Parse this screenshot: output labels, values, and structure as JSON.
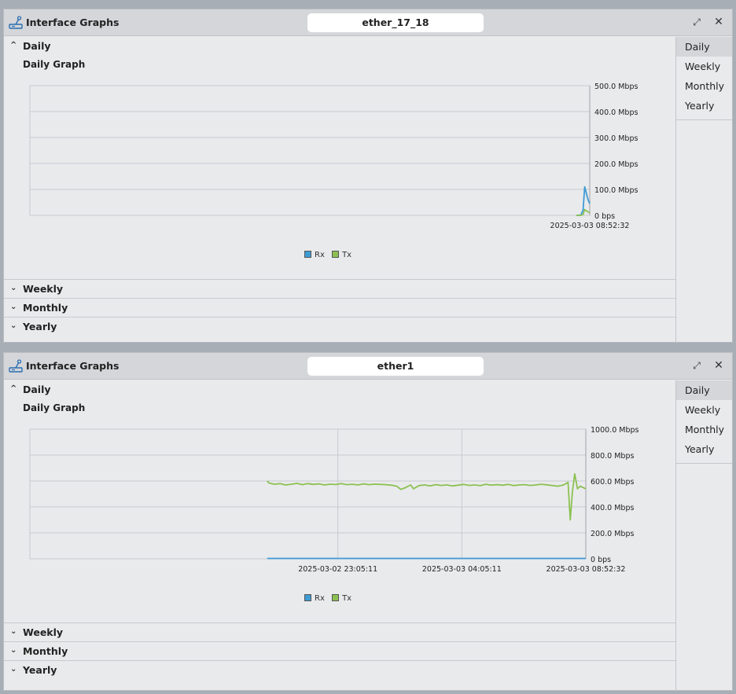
{
  "colors": {
    "rx": "#3d9bd4",
    "tx": "#8cc152",
    "grid": "#c8cbd0"
  },
  "windows": [
    {
      "title": "Interface Graphs",
      "interface": "ether_17_18",
      "icon": "interface-graph-icon",
      "sidebar": [
        "Daily",
        "Weekly",
        "Monthly",
        "Yearly"
      ],
      "sidebar_active": 0,
      "sections": {
        "daily": "Daily",
        "weekly": "Weekly",
        "monthly": "Monthly",
        "yearly": "Yearly"
      },
      "graph_title": "Daily Graph",
      "legend": {
        "rx": "Rx",
        "tx": "Tx"
      },
      "chart_data": {
        "type": "line",
        "y_ticks": [
          "500.0 Mbps",
          "400.0 Mbps",
          "300.0 Mbps",
          "200.0 Mbps",
          "100.0 Mbps",
          "0 bps"
        ],
        "ylim": [
          0,
          500
        ],
        "x_ticks": [
          {
            "label": "2025-03-03 08:52:32",
            "pos": 1.0
          }
        ],
        "xlim": [
          0,
          1
        ],
        "series": [
          {
            "name": "Rx",
            "points": [
              [
                0.976,
                0
              ],
              [
                0.984,
                1
              ],
              [
                0.988,
                20
              ],
              [
                0.991,
                110
              ],
              [
                0.994,
                85
              ],
              [
                0.997,
                60
              ],
              [
                1.0,
                45
              ]
            ]
          },
          {
            "name": "Tx",
            "points": [
              [
                0.976,
                0
              ],
              [
                0.984,
                0
              ],
              [
                0.988,
                3
              ],
              [
                0.991,
                22
              ],
              [
                0.994,
                18
              ],
              [
                0.997,
                13
              ],
              [
                1.0,
                10
              ]
            ]
          }
        ]
      }
    },
    {
      "title": "Interface Graphs",
      "interface": "ether1",
      "icon": "interface-graph-icon",
      "sidebar": [
        "Daily",
        "Weekly",
        "Monthly",
        "Yearly"
      ],
      "sidebar_active": 0,
      "sections": {
        "daily": "Daily",
        "weekly": "Weekly",
        "monthly": "Monthly",
        "yearly": "Yearly"
      },
      "graph_title": "Daily Graph",
      "legend": {
        "rx": "Rx",
        "tx": "Tx"
      },
      "chart_data": {
        "type": "line",
        "y_ticks": [
          "1000.0 Mbps",
          "800.0 Mbps",
          "600.0 Mbps",
          "400.0 Mbps",
          "200.0 Mbps",
          "0 bps"
        ],
        "ylim": [
          0,
          1000
        ],
        "x_ticks": [
          {
            "label": "2025-03-02 23:05:11",
            "pos": 0.554
          },
          {
            "label": "2025-03-03 04:05:11",
            "pos": 0.777
          },
          {
            "label": "2025-03-03 08:52:32",
            "pos": 1.0
          }
        ],
        "xlim": [
          0,
          1
        ],
        "series": [
          {
            "name": "Rx",
            "points": [
              [
                0.427,
                3
              ],
              [
                1.0,
                3
              ]
            ]
          },
          {
            "name": "Tx",
            "points": [
              [
                0.427,
                600
              ],
              [
                0.43,
                585
              ],
              [
                0.44,
                575
              ],
              [
                0.45,
                580
              ],
              [
                0.46,
                570
              ],
              [
                0.47,
                575
              ],
              [
                0.48,
                582
              ],
              [
                0.49,
                572
              ],
              [
                0.5,
                580
              ],
              [
                0.51,
                574
              ],
              [
                0.52,
                578
              ],
              [
                0.53,
                570
              ],
              [
                0.54,
                576
              ],
              [
                0.55,
                573
              ],
              [
                0.56,
                580
              ],
              [
                0.57,
                572
              ],
              [
                0.58,
                575
              ],
              [
                0.59,
                570
              ],
              [
                0.6,
                578
              ],
              [
                0.61,
                572
              ],
              [
                0.62,
                576
              ],
              [
                0.63,
                574
              ],
              [
                0.64,
                572
              ],
              [
                0.65,
                568
              ],
              [
                0.66,
                560
              ],
              [
                0.667,
                535
              ],
              [
                0.675,
                548
              ],
              [
                0.685,
                570
              ],
              [
                0.69,
                540
              ],
              [
                0.7,
                565
              ],
              [
                0.71,
                570
              ],
              [
                0.72,
                562
              ],
              [
                0.73,
                572
              ],
              [
                0.74,
                566
              ],
              [
                0.75,
                570
              ],
              [
                0.76,
                562
              ],
              [
                0.77,
                568
              ],
              [
                0.78,
                574
              ],
              [
                0.79,
                566
              ],
              [
                0.8,
                570
              ],
              [
                0.81,
                564
              ],
              [
                0.82,
                575
              ],
              [
                0.83,
                568
              ],
              [
                0.84,
                572
              ],
              [
                0.85,
                568
              ],
              [
                0.86,
                574
              ],
              [
                0.87,
                565
              ],
              [
                0.88,
                570
              ],
              [
                0.89,
                572
              ],
              [
                0.9,
                566
              ],
              [
                0.91,
                570
              ],
              [
                0.92,
                575
              ],
              [
                0.935,
                568
              ],
              [
                0.95,
                560
              ],
              [
                0.96,
                570
              ],
              [
                0.968,
                590
              ],
              [
                0.972,
                300
              ],
              [
                0.976,
                520
              ],
              [
                0.98,
                655
              ],
              [
                0.985,
                540
              ],
              [
                0.99,
                560
              ],
              [
                1.0,
                540
              ]
            ]
          }
        ]
      }
    }
  ]
}
